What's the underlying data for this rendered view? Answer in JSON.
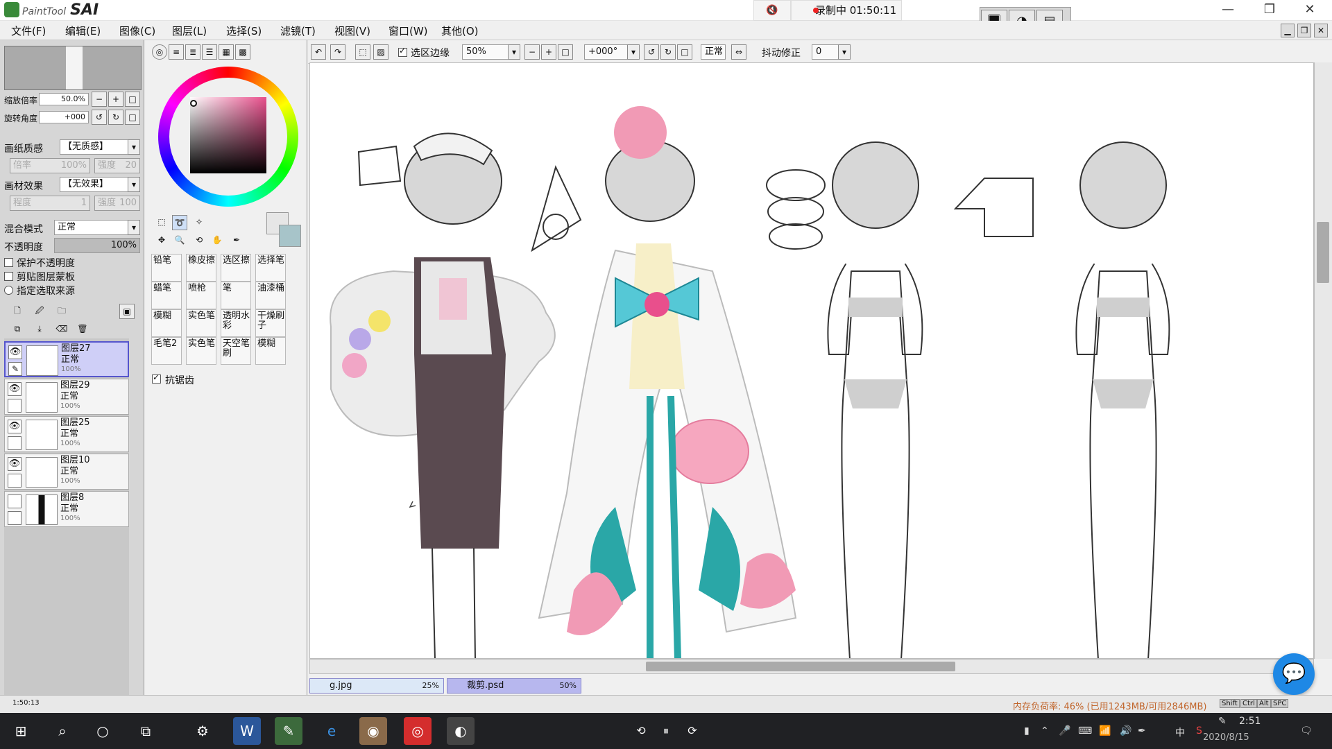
{
  "window": {
    "app_brand": "PaintTool",
    "app_title": "SAI",
    "recording_label": "录制中 01:50:11",
    "controls": [
      "—",
      "❐",
      "✕"
    ]
  },
  "menu": [
    "文件(F)",
    "编辑(E)",
    "图像(C)",
    "图层(L)",
    "选择(S)",
    "滤镜(T)",
    "视图(V)",
    "窗口(W)",
    "其他(O)"
  ],
  "nav": {
    "zoom_label": "缩放倍率",
    "zoom_value": "50.0%",
    "rotate_label": "旋转角度",
    "rotate_value": "+000"
  },
  "paper": {
    "texture_label": "画纸质感",
    "texture_value": "【无质感】",
    "scale_label": "倍率",
    "scale_value": "100%",
    "strength_label": "强度",
    "strength_value": "20",
    "effect_label": "画材效果",
    "effect_value": "【无效果】",
    "degree_label": "程度",
    "degree_value": "1",
    "strength2_label": "强度",
    "strength2_value": "100"
  },
  "blend": {
    "mode_label": "混合模式",
    "mode_value": "正常",
    "opacity_label": "不透明度",
    "opacity_value": "100%",
    "opacity_level": 1.0
  },
  "options": [
    {
      "label": "保护不透明度",
      "checked": false
    },
    {
      "label": "剪贴图层蒙板",
      "checked": false
    },
    {
      "label": "指定选取来源",
      "checked": false
    }
  ],
  "layers": [
    {
      "name": "图层27",
      "mode": "正常",
      "opacity": "100%",
      "visible": true,
      "selected": true
    },
    {
      "name": "图层29",
      "mode": "正常",
      "opacity": "100%",
      "visible": true,
      "selected": false
    },
    {
      "name": "图层25",
      "mode": "正常",
      "opacity": "100%",
      "visible": true,
      "selected": false
    },
    {
      "name": "图层10",
      "mode": "正常",
      "opacity": "100%",
      "visible": true,
      "selected": false
    },
    {
      "name": "图层8",
      "mode": "正常",
      "opacity": "100%",
      "visible": false,
      "selected": false
    }
  ],
  "tools": [
    "铅笔",
    "橡皮擦",
    "选区擦",
    "选择笔",
    "蜡笔",
    "喷枪",
    "笔",
    "油漆桶",
    "模糊",
    "实色笔",
    "透明水彩",
    "干燥刷子",
    "毛笔2",
    "实色笔",
    "天空笔刷",
    "模糊"
  ],
  "antialias_label": "抗锯齿",
  "toolbar": {
    "selection_edge_label": "选区边缘",
    "zoom_value": "50%",
    "rotate_value": "+000°",
    "mode_value": "正常",
    "stabilizer_label": "抖动修正",
    "stabilizer_value": "0"
  },
  "doc_tabs": [
    {
      "name": "g.jpg",
      "zoom": "25%"
    },
    {
      "name": "裁剪.psd",
      "zoom": "50%"
    }
  ],
  "status": {
    "time_left": "1:50:13",
    "memory": "内存负荷率: 46% (已用1243MB/可用2846MB)",
    "keys": [
      "Shift",
      "Ctrl",
      "Alt",
      "SPC"
    ]
  },
  "taskbar": {
    "time": "2:51",
    "date": "2020/8/15",
    "ime": "中"
  },
  "colors": {
    "accent_pink": "#e94f8c",
    "teal": "#2aa7a7",
    "selected_layer": "#cfcff7"
  }
}
